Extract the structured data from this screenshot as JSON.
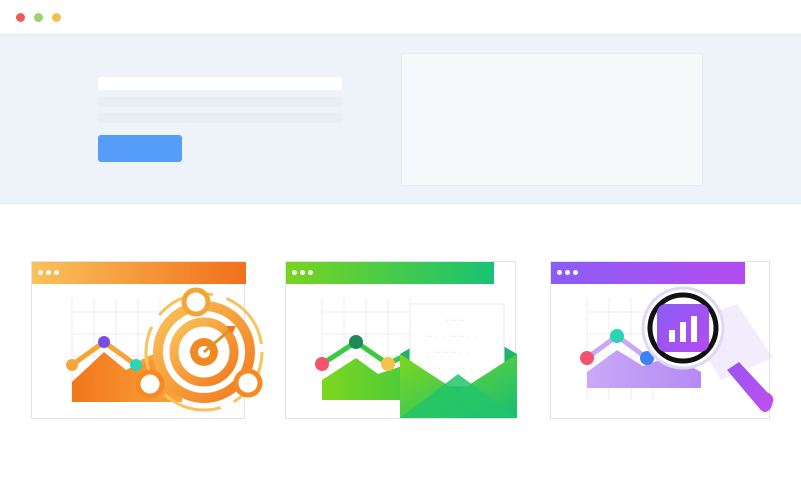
{
  "window": {
    "controls": [
      "close",
      "minimize",
      "maximize"
    ],
    "colors": {
      "close": "#f25a5a",
      "minimize": "#9ad36a",
      "maximize": "#f5c04a"
    }
  },
  "hero": {
    "cta_label": "",
    "background": "#eef3fa",
    "accent": "#559df9"
  },
  "cards": [
    {
      "name": "target-analytics",
      "bar_colors": [
        "#f9c25a",
        "#f26f1c"
      ],
      "icons": [
        "line-chart-icon",
        "target-icon",
        "arrow-icon"
      ]
    },
    {
      "name": "email-analytics",
      "bar_colors": [
        "#79d420",
        "#18c274"
      ],
      "icons": [
        "line-chart-icon",
        "envelope-icon",
        "letter-icon"
      ],
      "letter_lines": [
        "·····",
        "··· · ····· ·",
        "· ······· ·",
        "· ··· · ·· ·"
      ]
    },
    {
      "name": "search-analytics",
      "bar_colors": [
        "#8b5cf6",
        "#b24cf0"
      ],
      "icons": [
        "line-chart-icon",
        "magnifier-icon",
        "bar-chart-icon"
      ]
    }
  ]
}
